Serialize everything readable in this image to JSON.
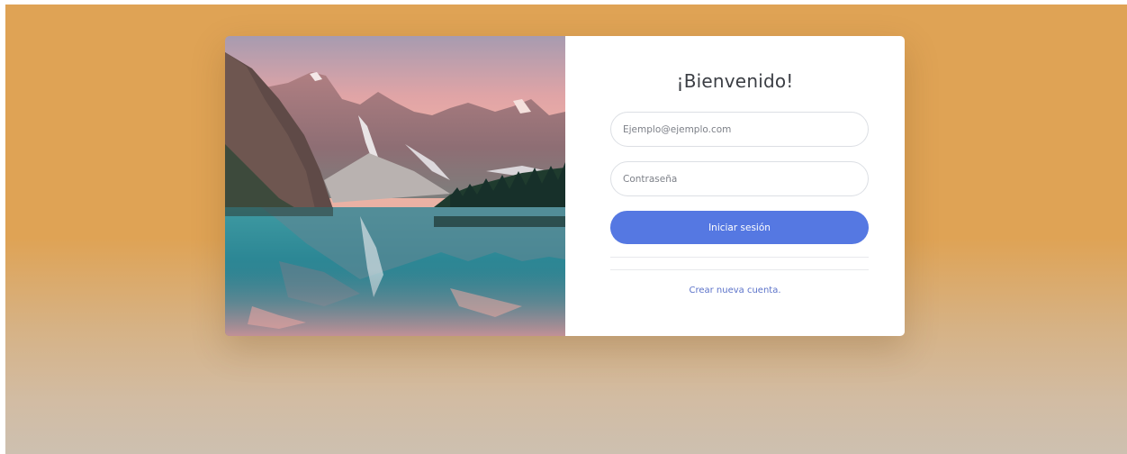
{
  "login": {
    "title": "¡Bienvenido!",
    "email_placeholder": "Ejemplo@ejemplo.com",
    "password_placeholder": "Contraseña",
    "submit_label": "Iniciar sesión",
    "create_account_link": "Crear nueva cuenta."
  },
  "colors": {
    "background_top": "#dfa355",
    "background_bottom": "#cdc0b0",
    "button": "#5578e2",
    "link": "#5c73c9"
  }
}
